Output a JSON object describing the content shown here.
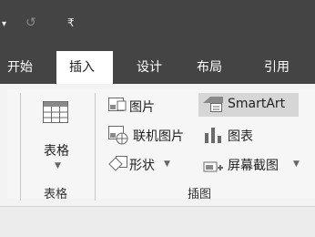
{
  "quick_access": {
    "undo_icon": "undo-arrow",
    "customize_icon": "dropdown-arrow"
  },
  "tabs": [
    {
      "label": "开始"
    },
    {
      "label": "插入"
    },
    {
      "label": "设计"
    },
    {
      "label": "布局"
    },
    {
      "label": "引用"
    }
  ],
  "ribbon": {
    "table_group": {
      "button_label": "表格",
      "group_label": "表格"
    },
    "illustrations_group": {
      "group_label": "插图",
      "items": [
        {
          "label": "图片"
        },
        {
          "label": "联机图片"
        },
        {
          "label": "形状"
        },
        {
          "label": "SmartArt"
        },
        {
          "label": "图表"
        },
        {
          "label": "屏幕截图"
        }
      ]
    }
  },
  "colors": {
    "titlebar": "#444444",
    "ribbon": "#f3f3f3",
    "active_tab": "#ffffff"
  }
}
